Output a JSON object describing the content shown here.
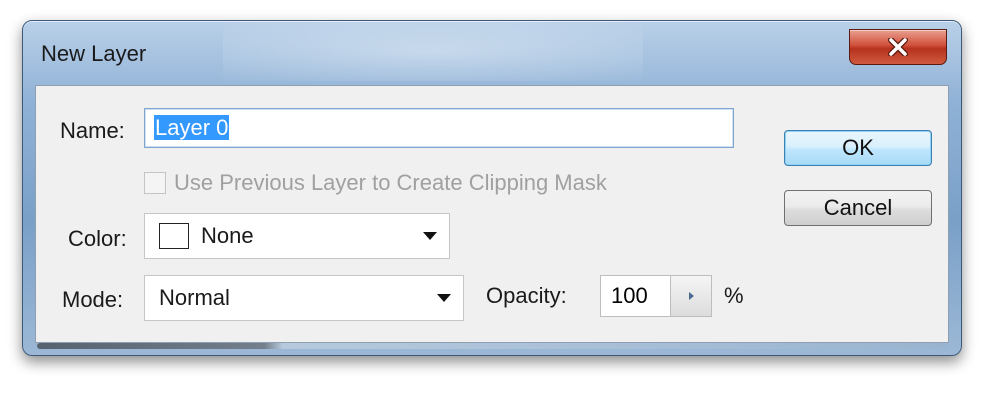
{
  "window": {
    "title": "New Layer",
    "close_icon": "close-icon"
  },
  "form": {
    "name_label": "Name:",
    "name_value": "Layer 0",
    "clipping_label": "Use Previous Layer to Create Clipping Mask",
    "clipping_checked": false,
    "clipping_enabled": false,
    "color_label": "Color:",
    "color_value": "None",
    "mode_label": "Mode:",
    "mode_value": "Normal",
    "opacity_label": "Opacity:",
    "opacity_value": "100",
    "opacity_unit": "%"
  },
  "buttons": {
    "ok": "OK",
    "cancel": "Cancel"
  },
  "colors": {
    "selection": "#3399ff",
    "ok_border": "#3c7fb1",
    "close_red": "#c9452f"
  }
}
